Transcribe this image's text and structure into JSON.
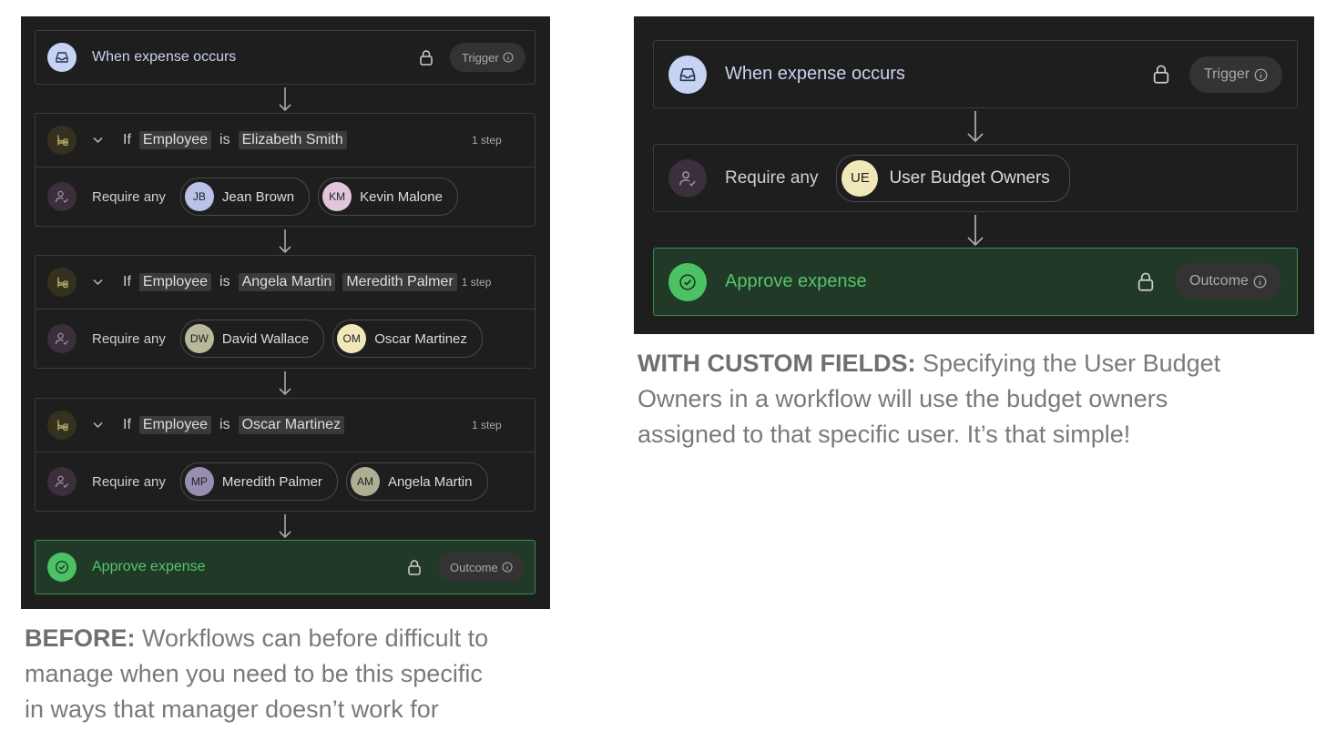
{
  "left": {
    "trigger": {
      "title": "When expense occurs",
      "badge": "Trigger"
    },
    "conditions": [
      {
        "if_label": "If",
        "field": "Employee",
        "is_label": "is",
        "values": [
          "Elizabeth Smith"
        ],
        "steps": "1 step",
        "require_label": "Require any",
        "approvers": [
          {
            "initials": "JB",
            "name": "Jean Brown",
            "color": "#b9c3e8"
          },
          {
            "initials": "KM",
            "name": "Kevin Malone",
            "color": "#e2c6dd"
          }
        ]
      },
      {
        "if_label": "If",
        "field": "Employee",
        "is_label": "is",
        "values": [
          "Angela Martin",
          "Meredith Palmer"
        ],
        "steps": "1 step",
        "require_label": "Require any",
        "approvers": [
          {
            "initials": "DW",
            "name": "David Wallace",
            "color": "#b9b89a"
          },
          {
            "initials": "OM",
            "name": "Oscar Martinez",
            "color": "#f1e8b9"
          }
        ]
      },
      {
        "if_label": "If",
        "field": "Employee",
        "is_label": "is",
        "values": [
          "Oscar Martinez"
        ],
        "steps": "1 step",
        "require_label": "Require any",
        "approvers": [
          {
            "initials": "MP",
            "name": "Meredith Palmer",
            "color": "#9a8eb0"
          },
          {
            "initials": "AM",
            "name": "Angela Martin",
            "color": "#aeae95"
          }
        ]
      }
    ],
    "outcome": {
      "title": "Approve expense",
      "badge": "Outcome"
    },
    "caption": {
      "bold": "BEFORE:",
      "lines": [
        " Workflows can before difficult to",
        "manage when you need to be this specific",
        "in ways that manager doesn’t work for"
      ]
    }
  },
  "right": {
    "trigger": {
      "title": "When expense occurs",
      "badge": "Trigger"
    },
    "require_label": "Require any",
    "approver": {
      "initials": "UE",
      "name": "User Budget Owners",
      "color": "#f1e8b9"
    },
    "outcome": {
      "title": "Approve expense",
      "badge": "Outcome"
    },
    "caption": {
      "bold": "WITH CUSTOM FIELDS:",
      "lines": [
        " Specifying the User Budget",
        "Owners in a workflow will use the budget owners",
        "assigned to that specific user. It’s that simple!"
      ]
    }
  },
  "icons": {
    "trigger": "inbox-icon",
    "lock": "lock-icon",
    "info": "info-icon",
    "branch": "branch-icon",
    "chevron": "chevron-down-icon",
    "approver": "user-check-icon",
    "outcome": "check-circle-icon",
    "arrow": "arrow-down-icon"
  },
  "colors": {
    "panel_bg": "#1e1e1e",
    "outcome_bg": "#213a27",
    "outcome_border": "#3f8a4f",
    "success": "#4cc265",
    "trigger_icon_bg": "#c7d3f3"
  }
}
